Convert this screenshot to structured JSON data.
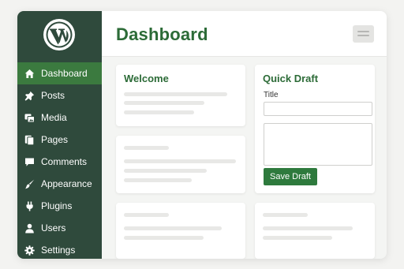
{
  "sidebar": {
    "items": [
      {
        "label": "Dashboard",
        "icon": "home-icon",
        "active": true
      },
      {
        "label": "Posts",
        "icon": "pushpin-icon"
      },
      {
        "label": "Media",
        "icon": "media-icon"
      },
      {
        "label": "Pages",
        "icon": "pages-icon"
      },
      {
        "label": "Comments",
        "icon": "comment-icon"
      },
      {
        "label": "Appearance",
        "icon": "brush-icon"
      },
      {
        "label": "Plugins",
        "icon": "plugin-icon"
      },
      {
        "label": "Users",
        "icon": "user-icon"
      },
      {
        "label": "Settings",
        "icon": "gear-icon"
      }
    ]
  },
  "header": {
    "title": "Dashboard"
  },
  "welcome": {
    "title": "Welcome"
  },
  "quick_draft": {
    "title": "Quick Draft",
    "title_label": "Title",
    "title_value": "",
    "content_value": "",
    "save_label": "Save Draft"
  },
  "colors": {
    "sidebar_bg": "#2f4a3c",
    "active_item": "#3b7a3f",
    "accent_green": "#2c6b37",
    "button_green": "#2e7a3d"
  }
}
